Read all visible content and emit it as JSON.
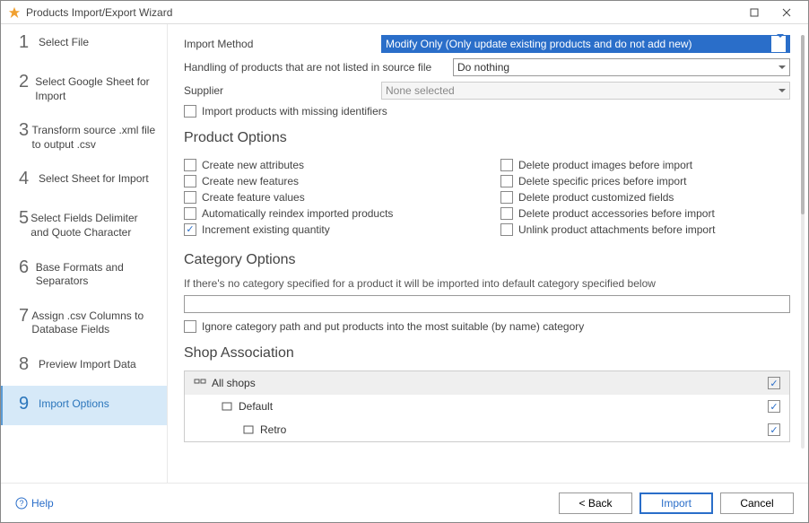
{
  "window": {
    "title": "Products Import/Export Wizard"
  },
  "sidebar": {
    "steps": [
      {
        "label": "Select File"
      },
      {
        "label": "Select Google Sheet for Import"
      },
      {
        "label": "Transform source .xml file to output .csv"
      },
      {
        "label": "Select Sheet for Import"
      },
      {
        "label": "Select Fields Delimiter and Quote Character"
      },
      {
        "label": "Base Formats and Separators"
      },
      {
        "label": "Assign .csv Columns to Database Fields"
      },
      {
        "label": "Preview Import Data"
      },
      {
        "label": "Import Options"
      }
    ]
  },
  "form": {
    "import_method_label": "Import Method",
    "import_method_value": "Modify Only (Only update existing products and do not add new)",
    "handling_label": "Handling of products that are not listed in source file",
    "handling_value": "Do nothing",
    "supplier_label": "Supplier",
    "supplier_value": "None selected",
    "missing_ids_label": "Import products with missing identifiers"
  },
  "product_options": {
    "heading": "Product Options",
    "left": [
      {
        "label": "Create new attributes",
        "checked": false
      },
      {
        "label": "Create new features",
        "checked": false
      },
      {
        "label": "Create feature values",
        "checked": false
      },
      {
        "label": "Automatically reindex imported products",
        "checked": false
      },
      {
        "label": "Increment existing quantity",
        "checked": true
      }
    ],
    "right": [
      {
        "label": "Delete product images before import",
        "checked": false
      },
      {
        "label": "Delete specific prices before import",
        "checked": false
      },
      {
        "label": "Delete product customized fields",
        "checked": false
      },
      {
        "label": "Delete product accessories before import",
        "checked": false
      },
      {
        "label": "Unlink product attachments before import",
        "checked": false
      }
    ]
  },
  "category_options": {
    "heading": "Category Options",
    "hint": "If there's no category specified for a product it will be imported into default category specified below",
    "ignore_label": "Ignore category path and put products into the most suitable (by name) category"
  },
  "shop_assoc": {
    "heading": "Shop Association",
    "rows": [
      {
        "name": "All shops",
        "checked": true,
        "indent": 0
      },
      {
        "name": "Default",
        "checked": true,
        "indent": 1
      },
      {
        "name": "Retro",
        "checked": true,
        "indent": 2
      }
    ]
  },
  "footer": {
    "help": "Help",
    "back": "< Back",
    "import": "Import",
    "cancel": "Cancel"
  }
}
